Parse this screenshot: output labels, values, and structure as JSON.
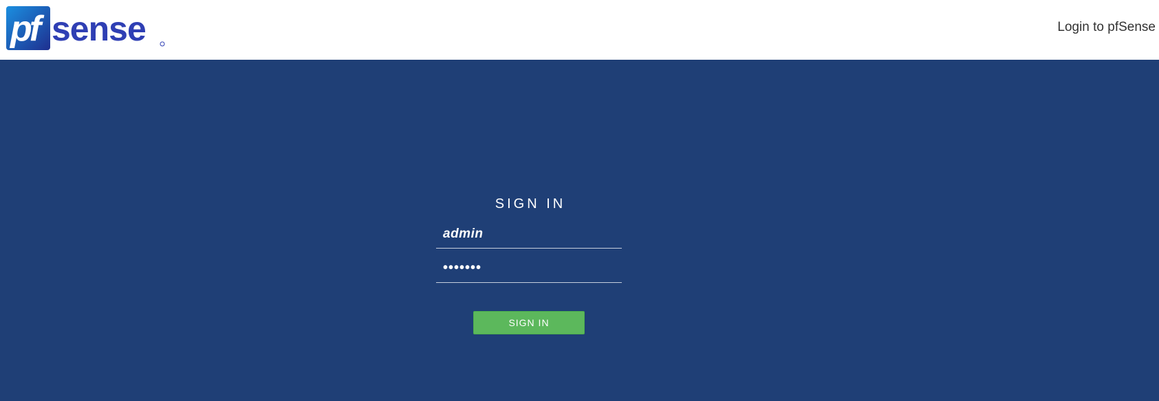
{
  "header": {
    "logo_text": "pfsense",
    "title": "Login to pfSense"
  },
  "login": {
    "heading": "SIGN IN",
    "username_value": "admin",
    "password_value": "•••••••",
    "button_label": "SIGN IN"
  },
  "colors": {
    "background": "#1f3f76",
    "header_background": "#ffffff",
    "button": "#5cb85c",
    "logo_blue": "#2f3fb4"
  },
  "icons": {
    "logo": "pfsense-logo-icon"
  }
}
